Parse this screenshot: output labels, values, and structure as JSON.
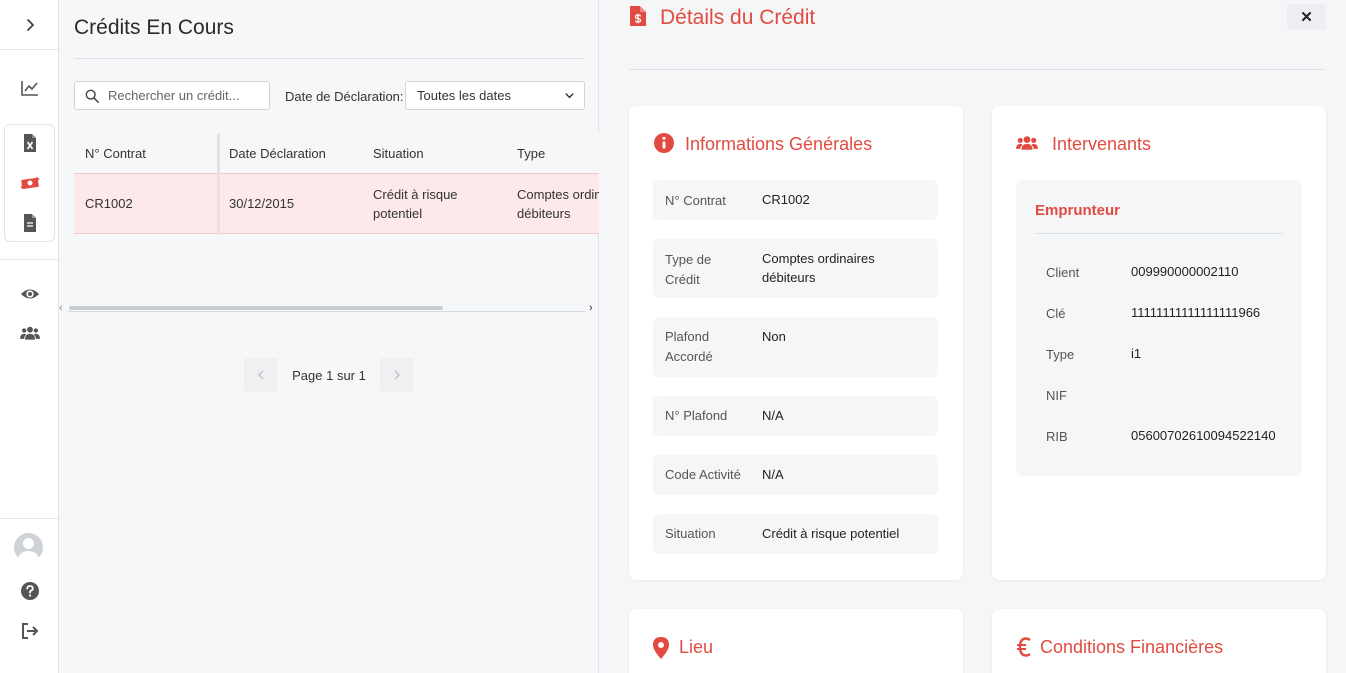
{
  "sidebar": {
    "items": [
      {
        "name": "expand-icon"
      },
      {
        "name": "chart-line-icon"
      },
      {
        "name": "file-excel-icon"
      },
      {
        "name": "money-bill-icon",
        "active": true
      },
      {
        "name": "file-icon"
      },
      {
        "name": "eye-icon"
      },
      {
        "name": "users-icon"
      },
      {
        "name": "help-icon"
      },
      {
        "name": "logout-icon"
      }
    ],
    "accent": "#e24b41"
  },
  "list": {
    "title": "Crédits En Cours",
    "search_placeholder": "Rechercher un crédit...",
    "date_filter_label": "Date de Déclaration:",
    "date_filter_value": "Toutes les dates",
    "columns": [
      "N° Contrat",
      "Date Déclaration",
      "Situation",
      "Type"
    ],
    "rows": [
      {
        "contrat": "CR1002",
        "date": "30/12/2015",
        "situation_l1": "Crédit à risque",
        "situation_l2": "potentiel",
        "type_l1": "Comptes ordinaires",
        "type_l2": "débiteurs"
      }
    ],
    "pagination": "Page 1 sur 1"
  },
  "detail": {
    "title": "Détails du Crédit",
    "close_label": "✕",
    "general": {
      "title": "Informations Générales",
      "rows": [
        {
          "key": "N° Contrat",
          "value": "CR1002"
        },
        {
          "key": "Type de Crédit",
          "value": "Comptes ordinaires débiteurs"
        },
        {
          "key": "Plafond Accordé",
          "value": "Non"
        },
        {
          "key": "N° Plafond",
          "value": "N/A"
        },
        {
          "key": "Code Activité",
          "value": "N/A"
        },
        {
          "key": "Situation",
          "value": "Crédit à risque potentiel"
        }
      ]
    },
    "intervenants": {
      "title": "Intervenants",
      "emprunteur": {
        "title": "Emprunteur",
        "rows": [
          {
            "key": "Client",
            "value": "009990000002110"
          },
          {
            "key": "Clé",
            "value": "11111111111111111966"
          },
          {
            "key": "Type",
            "value": "i1"
          },
          {
            "key": "NIF",
            "value": ""
          },
          {
            "key": "RIB",
            "value": "05600702610094522140"
          }
        ]
      }
    },
    "lieu": {
      "title": "Lieu"
    },
    "conditions": {
      "title": "Conditions Financières"
    }
  }
}
